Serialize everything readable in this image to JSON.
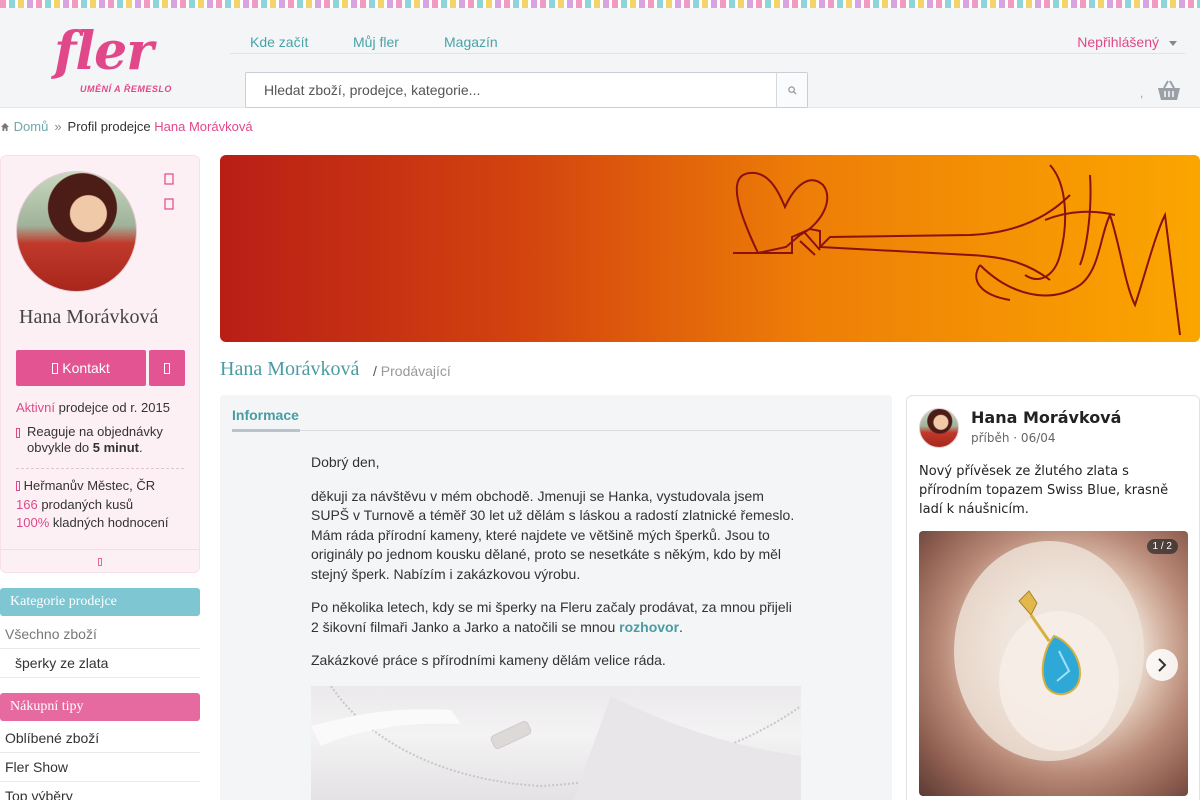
{
  "brand": {
    "logo_word": "fler",
    "logo_sub": "UMĚNÍ A ŘEMESLO",
    "accent": "#e1488a",
    "teal": "#4a9ca3"
  },
  "topnav": {
    "items": [
      {
        "label": "Kde začít"
      },
      {
        "label": "Můj fler"
      },
      {
        "label": "Magazín"
      }
    ],
    "user_menu": "Nepřihlášený"
  },
  "search": {
    "placeholder": "Hledat zboží, prodejce, kategorie...",
    "button_icon": "search-icon"
  },
  "cart": {
    "count": ",",
    "icon": "basket-icon"
  },
  "breadcrumb": {
    "home": "Domů",
    "sep": "»",
    "current_prefix": "Profil prodejce",
    "current_name": "Hana Morávková"
  },
  "profile": {
    "name": "Hana Morávková",
    "contact_label": "Kontakt",
    "active_label": "Aktivní",
    "since_text": "prodejce od r. 2015",
    "response_prefix": "Reaguje na objednávky obvykle do",
    "response_time": "5 minut",
    "response_suffix": ".",
    "location": "Heřmanův Městec, ČR",
    "sold_count": "166",
    "sold_label": "prodaných kusů",
    "positive_pct": "100%",
    "positive_label": "kladných hodnocení"
  },
  "seller_categories": {
    "title": "Kategorie prodejce",
    "items": [
      {
        "label": "Všechno zboží"
      },
      {
        "label": "šperky ze zlata"
      }
    ]
  },
  "shopping_tips": {
    "title": "Nákupní tipy",
    "items": [
      {
        "label": "Oblíbené zboží"
      },
      {
        "label": "Fler Show"
      },
      {
        "label": "Top výběry"
      }
    ]
  },
  "seller_heading": {
    "name": "Hana Morávková",
    "sep": "/",
    "role": "Prodávající"
  },
  "info": {
    "tab": "Informace",
    "p1": "Dobrý den,",
    "p2": "děkuji za návštěvu v mém obchodě. Jmenuji se Hanka, vystudovala jsem SUPŠ v Turnově a téměř 30 let už dělám s láskou a radostí zlatnické řemeslo. Mám ráda přírodní kameny, které najdete ve většině mých šperků. Jsou to originály po jednom kousku dělané, proto se nesetkáte s někým, kdo by měl stejný šperk. Nabízím i zakázkovou výrobu.",
    "p3_before": "Po několika letech, kdy se mi šperky na Fleru začaly prodávat, za mnou přijeli 2 šikovní filmaři Janko a Jarko a natočili se mnou ",
    "p3_link": "rozhovor",
    "p3_after": ".",
    "p4": "Zakázkové práce s přírodními kameny dělám velice ráda."
  },
  "story": {
    "name": "Hana Morávková",
    "meta": "příběh · 06/04",
    "text": "Nový přívěsek ze žlutého zlata s přírodním topazem Swiss Blue, krasně ladí k náušnicím.",
    "counter": "1 / 2",
    "next_icon": "chevron-right-icon"
  }
}
